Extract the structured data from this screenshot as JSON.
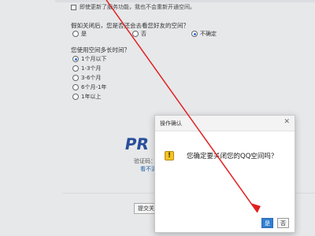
{
  "survey": {
    "q0_option": "即使更新了服务功能，我也不会重新开通空间。",
    "q1": {
      "title": "假如关闭后，您是否还会去看您好友的空间？",
      "options": [
        "是",
        "否",
        "不确定"
      ],
      "selected_index": 2
    },
    "q2": {
      "title": "您使用空间多长时间？",
      "options": [
        "1个月以下",
        "1-3个月",
        "3-6个月",
        "6个月-1年",
        "1年以上"
      ],
      "selected_index": 0
    },
    "captcha": {
      "image_text": "PR",
      "label": "验证码：",
      "refresh_link": "看不清"
    },
    "submit_label": "提交关闭"
  },
  "dialog": {
    "title": "操作确认",
    "close_symbol": "✕",
    "icon": "warning-icon",
    "message": "您确定要关闭您的QQ空间吗？",
    "confirm_label": "是",
    "cancel_label": "否"
  },
  "annotation": {
    "arrow_color": "#e02020"
  },
  "colors": {
    "primary_button": "#2f7fd2",
    "link": "#1f5fa8"
  }
}
